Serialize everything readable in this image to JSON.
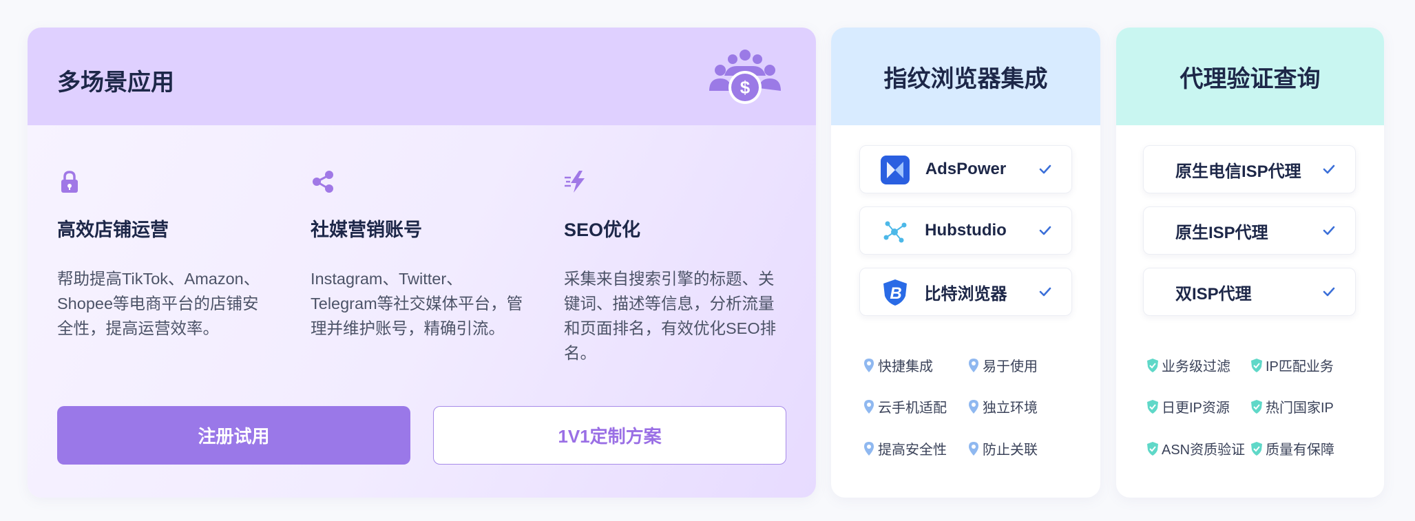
{
  "main": {
    "title": "多场景应用",
    "features": [
      {
        "title": "高效店铺运营",
        "desc": "帮助提高TikTok、Amazon、Shopee等电商平台的店铺安全性，提高运营效率。"
      },
      {
        "title": "社媒营销账号",
        "desc": "Instagram、Twitter、Telegram等社交媒体平台，管理并维护账号，精确引流。"
      },
      {
        "title": "SEO优化",
        "desc": "采集来自搜索引擎的标题、关键词、描述等信息，分析流量和页面排名，有效优化SEO排名。"
      }
    ],
    "buttons": {
      "register": "注册试用",
      "custom": "1V1定制方案"
    }
  },
  "fingerprint": {
    "title": "指纹浏览器集成",
    "items": [
      "AdsPower",
      "Hubstudio",
      "比特浏览器"
    ],
    "tags": [
      "快捷集成",
      "易于使用",
      "云手机适配",
      "独立环境",
      "提高安全性",
      "防止关联"
    ]
  },
  "proxy": {
    "title": "代理验证查询",
    "items": [
      "原生电信ISP代理",
      "原生ISP代理",
      "双ISP代理"
    ],
    "tags": [
      "业务级过滤",
      "IP匹配业务",
      "日更IP资源",
      "热门国家IP",
      "ASN资质验证",
      "质量有保障"
    ]
  },
  "colors": {
    "accent_purple": "#9a78e8",
    "main_header": "#dfd0ff",
    "fingerprint_header": "#d8ebff",
    "proxy_header": "#c9f6f1",
    "check_blue": "#3b6fd8",
    "pin_blue": "#8fb8f0",
    "shield_teal": "#5fd8c8"
  },
  "icons": {
    "header": "people-money-icon",
    "features": [
      "lock-icon",
      "share-icon",
      "lightning-icon"
    ],
    "fingerprint_logos": [
      "adspower-logo-icon",
      "hubstudio-logo-icon",
      "bitbrowser-logo-icon"
    ],
    "check": "check-icon",
    "fingerprint_tag": "location-pin-icon",
    "proxy_tag": "shield-check-icon"
  }
}
